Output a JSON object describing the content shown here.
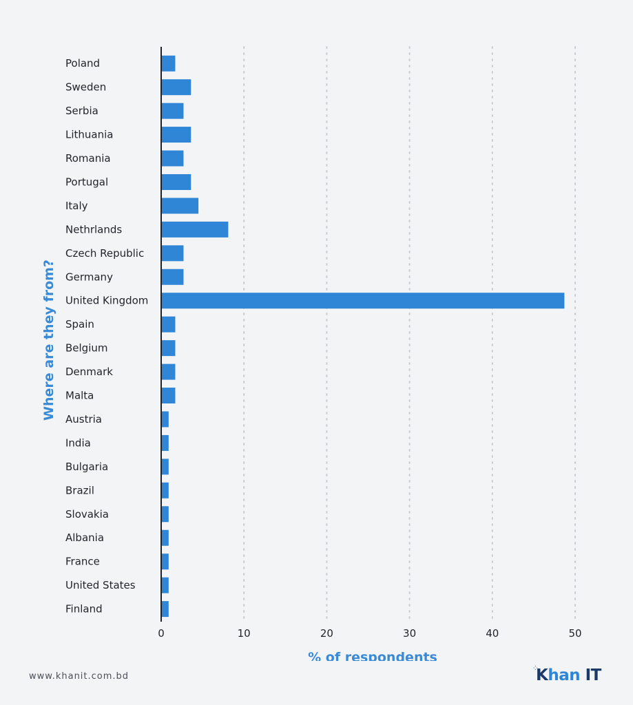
{
  "chart_data": {
    "type": "bar",
    "orientation": "horizontal",
    "title": "",
    "xlabel": "% of respondents",
    "ylabel": "Where are they from?",
    "xlim": [
      0,
      50
    ],
    "xticks": [
      0,
      10,
      20,
      30,
      40,
      50
    ],
    "grid": "vertical dotted",
    "bar_color": "#2f86d6",
    "axis_title_color": "#3a8ad6",
    "categories": [
      "Poland",
      "Sweden",
      "Serbia",
      "Lithuania",
      "Romania",
      "Portugal",
      "Italy",
      "Nethrlands",
      "Czech Republic",
      "Germany",
      "United Kingdom",
      "Spain",
      "Belgium",
      "Denmark",
      "Malta",
      "Austria",
      "India",
      "Bulgaria",
      "Brazil",
      "Slovakia",
      "Albania",
      "France",
      "United States",
      "Finland"
    ],
    "values": [
      1.7,
      3.6,
      2.7,
      3.6,
      2.7,
      3.6,
      4.5,
      8.1,
      2.7,
      2.7,
      48.7,
      1.7,
      1.7,
      1.7,
      1.7,
      0.9,
      0.9,
      0.9,
      0.9,
      0.9,
      0.9,
      0.9,
      0.9,
      0.9
    ]
  },
  "footer": {
    "url": "www.khanit.com.bd",
    "logo_k": "K",
    "logo_rest": "han",
    "logo_it": " IT",
    "logo_dots": "⁘"
  }
}
